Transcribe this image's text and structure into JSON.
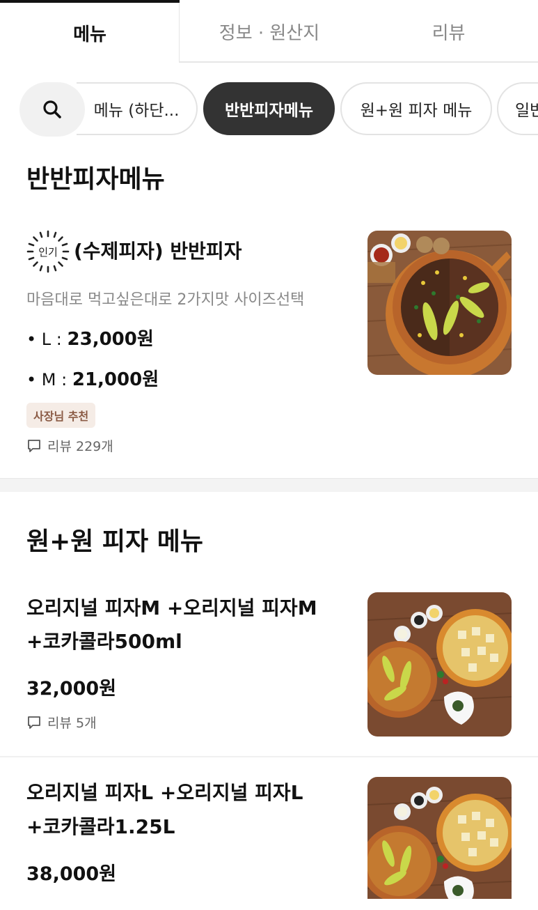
{
  "tabs": [
    {
      "label": "메뉴"
    },
    {
      "label": "정보 · 원산지"
    },
    {
      "label": "리뷰"
    }
  ],
  "chips": [
    {
      "label": "메뉴 (하단..."
    },
    {
      "label": "반반피자메뉴",
      "selected": true
    },
    {
      "label": "원+원 피자 메뉴"
    },
    {
      "label": "일반"
    }
  ],
  "sections": [
    {
      "title": "반반피자메뉴",
      "items": [
        {
          "badge_icon_text": "인기",
          "name": "(수제피자) 반반피자",
          "description": "마음대로 먹고싶은대로 2가지맛 사이즈선택",
          "prices": [
            {
              "size": "• L :",
              "price": "23,000원"
            },
            {
              "size": "• M :",
              "price": "21,000원"
            }
          ],
          "tag": "사장님 추천",
          "reviews": "리뷰 229개"
        }
      ]
    },
    {
      "title": "원+원 피자 메뉴",
      "items": [
        {
          "name_line1": "오리지널 피자M +오리지널 피자M",
          "name_line2": "+코카콜라500ml",
          "price": "32,000원",
          "reviews": "리뷰 5개"
        },
        {
          "name_line1": "오리지널 피자L +오리지널 피자L",
          "name_line2": "+코카콜라1.25L",
          "price": "38,000원"
        }
      ]
    }
  ],
  "colors": {
    "accent_dark": "#333333",
    "tag_bg": "#f5ece6",
    "tag_text": "#8a5a44"
  }
}
